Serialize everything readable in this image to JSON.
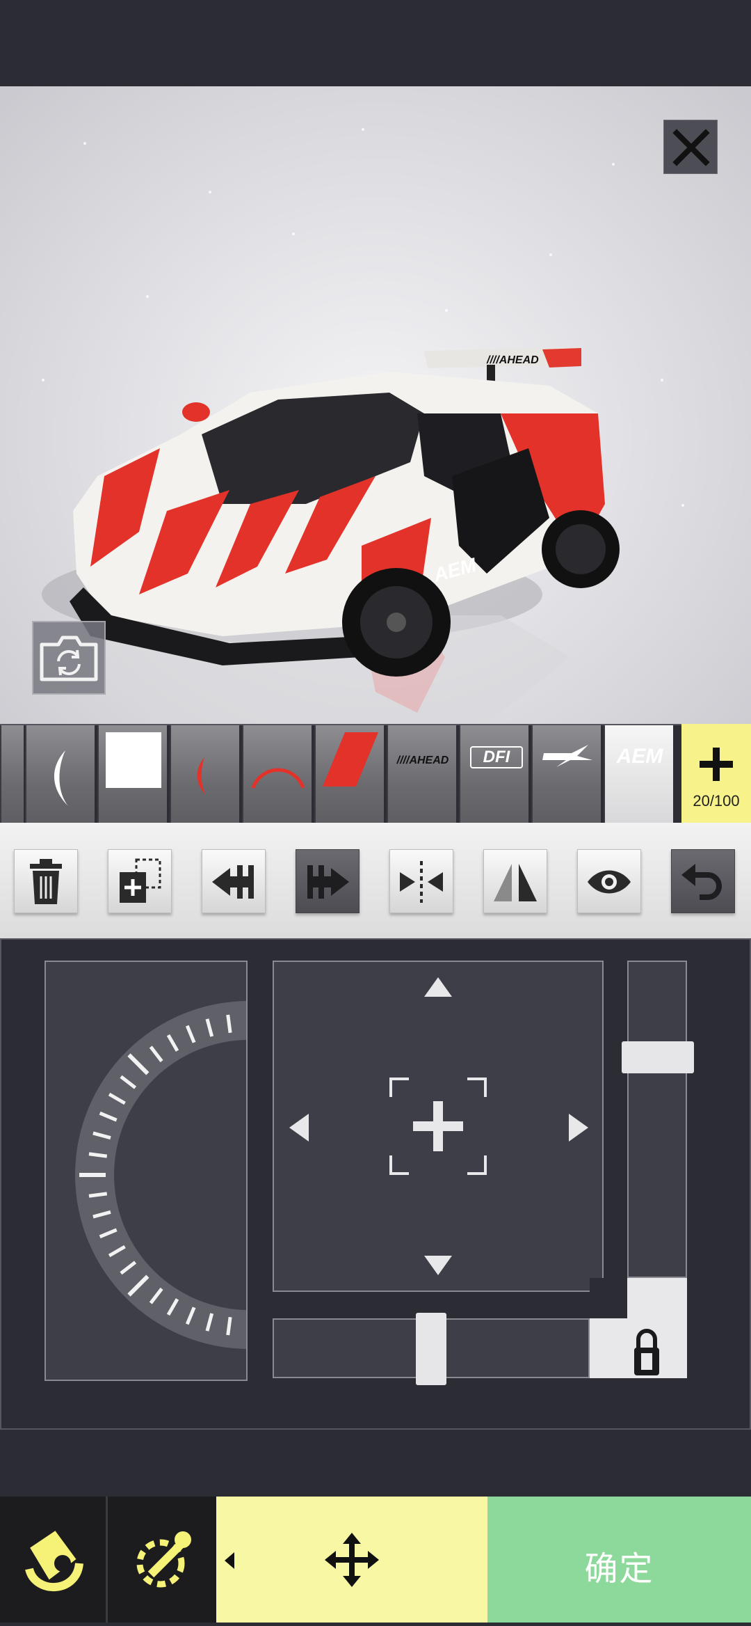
{
  "viewport": {
    "car_livery_text": [
      "////AHEAD",
      "AEM"
    ]
  },
  "decal_strip": {
    "items": [
      {
        "id": "partial",
        "icon": "decal-partial"
      },
      {
        "id": "crescent-white",
        "icon": "crescent-icon"
      },
      {
        "id": "square-white",
        "icon": "square-icon"
      },
      {
        "id": "crescent-red",
        "icon": "crescent-icon"
      },
      {
        "id": "arc-red",
        "icon": "arc-icon"
      },
      {
        "id": "slash-red",
        "icon": "slash-icon"
      },
      {
        "id": "ahead-logo",
        "text": "////AHEAD"
      },
      {
        "id": "dfi-logo",
        "text": "DFI"
      },
      {
        "id": "k-logo",
        "icon": "k-logo-icon"
      },
      {
        "id": "aem-logo",
        "text": "AEM",
        "selected": true
      }
    ],
    "count_label": "20/100",
    "accent": "#f7f28a"
  },
  "tools": [
    {
      "name": "delete-button",
      "icon": "trash-icon"
    },
    {
      "name": "duplicate-button",
      "icon": "duplicate-icon"
    },
    {
      "name": "flip-horizontal-left-button",
      "icon": "flip-left-icon"
    },
    {
      "name": "flip-horizontal-right-button",
      "icon": "flip-right-icon",
      "active": true
    },
    {
      "name": "mirror-center-button",
      "icon": "mirror-icon"
    },
    {
      "name": "mirror-triangle-button",
      "icon": "mirror-triangle-icon"
    },
    {
      "name": "visibility-button",
      "icon": "eye-icon"
    },
    {
      "name": "undo-button",
      "icon": "undo-icon",
      "active": true
    }
  ],
  "controls": {
    "scale_slider_level": 0.72,
    "width_slider_level": 0.5,
    "lock_icon": "lock-icon"
  },
  "bottom_nav": {
    "paint_label": "",
    "decal_label": "",
    "move_label": "",
    "confirm_label": "确定",
    "colors": {
      "dark": "#1c1c1e",
      "move": "#f8f8a4",
      "confirm": "#8cd99b"
    }
  }
}
